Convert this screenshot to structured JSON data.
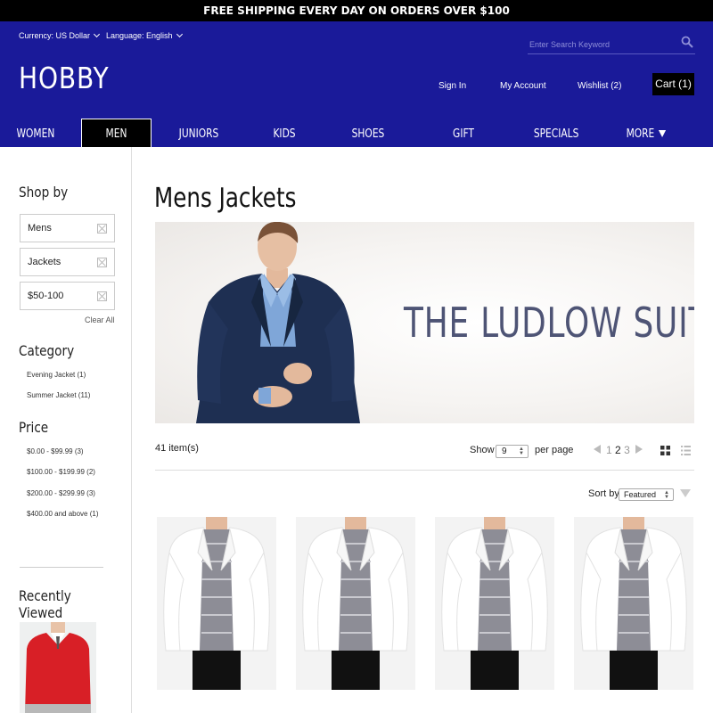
{
  "promo": {
    "text": "FREE SHIPPING EVERY DAY ON ORDERS OVER $100"
  },
  "header": {
    "currency": "Currency: US Dollar",
    "language": "Language: English",
    "search_placeholder": "Enter Search Keyword",
    "logo": "HOBBY",
    "links": {
      "sign_in": "Sign In",
      "account": "My Account",
      "wishlist": "Wishlist (2)",
      "cart": "Cart (1)"
    },
    "colors": {
      "brand": "#1a1a99",
      "dark": "#000000"
    }
  },
  "nav": {
    "items": [
      {
        "label": "WOMEN"
      },
      {
        "label": "MEN"
      },
      {
        "label": "JUNIORS"
      },
      {
        "label": "KIDS"
      },
      {
        "label": "SHOES"
      },
      {
        "label": "GIFT CARDS"
      },
      {
        "label": "SPECIALS"
      },
      {
        "label": "MORE"
      }
    ],
    "active": "MEN"
  },
  "sidebar": {
    "shop_by_title": "Shop by",
    "filters": [
      {
        "label": "Mens"
      },
      {
        "label": "Jackets"
      },
      {
        "label": "$50-100"
      }
    ],
    "clear_all": "Clear All",
    "category_title": "Category",
    "categories": [
      {
        "label": "Evening Jacket (1)"
      },
      {
        "label": "Summer Jacket (11)"
      }
    ],
    "price_title": "Price",
    "prices": [
      {
        "label": "$0.00 - $99.99 (3)"
      },
      {
        "label": "$100.00 - $199.99 (2)"
      },
      {
        "label": "$200.00 - $299.99 (3)"
      },
      {
        "label": "$400.00 and above (1)"
      }
    ],
    "recent_title": "Recently Viewed"
  },
  "main": {
    "title": "Mens Jackets",
    "banner_text": "THE LUDLOW SUIT",
    "item_count": "41 item(s)",
    "show_label": "Show",
    "per_page_value": "9",
    "per_page_label": "per page",
    "pages": {
      "p1": "1",
      "p2": "2",
      "p3": "3"
    },
    "sort_label": "Sort by",
    "sort_value": "Featured"
  }
}
